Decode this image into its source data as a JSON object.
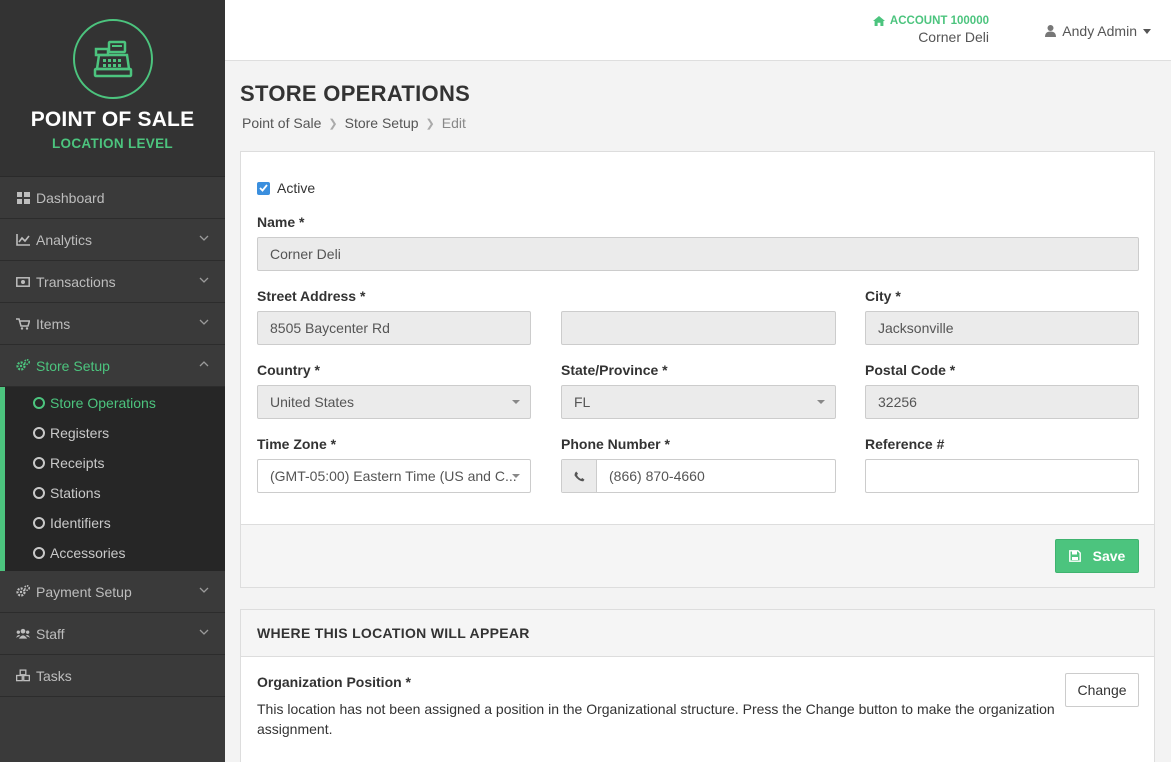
{
  "brand": {
    "title": "POINT OF SALE",
    "subtitle": "LOCATION LEVEL",
    "logo_icon": "cash-register-icon",
    "accent": "#4cc47e"
  },
  "sidebar": {
    "items": [
      {
        "label": "Dashboard",
        "icon": "dashboard-icon"
      },
      {
        "label": "Analytics",
        "icon": "chart-icon"
      },
      {
        "label": "Transactions",
        "icon": "money-icon"
      },
      {
        "label": "Items",
        "icon": "cart-icon"
      },
      {
        "label": "Store Setup",
        "icon": "cogs-icon"
      },
      {
        "label": "Payment Setup",
        "icon": "cogs-icon"
      },
      {
        "label": "Staff",
        "icon": "users-icon"
      },
      {
        "label": "Tasks",
        "icon": "cubes-icon"
      }
    ],
    "store_setup_sub": [
      "Store Operations",
      "Registers",
      "Receipts",
      "Stations",
      "Identifiers",
      "Accessories"
    ]
  },
  "topbar": {
    "account": "ACCOUNT 100000",
    "account_name": "Corner Deli",
    "user": "Andy Admin"
  },
  "page": {
    "title": "STORE OPERATIONS",
    "breadcrumb": [
      "Point of Sale",
      "Store Setup",
      "Edit"
    ]
  },
  "form": {
    "active_label": "Active",
    "active_checked": true,
    "name_label": "Name *",
    "name_value": "Corner Deli",
    "street_label": "Street Address *",
    "street_value": "8505 Baycenter Rd",
    "street2_value": "",
    "city_label": "City *",
    "city_value": "Jacksonville",
    "country_label": "Country *",
    "country_value": "United States",
    "state_label": "State/Province *",
    "state_value": "FL",
    "postal_label": "Postal Code *",
    "postal_value": "32256",
    "timezone_label": "Time Zone *",
    "timezone_value": "(GMT-05:00) Eastern Time (US and C...",
    "phone_label": "Phone Number *",
    "phone_value": "(866) 870-4660",
    "reference_label": "Reference #",
    "reference_value": "",
    "save_label": "Save"
  },
  "location_panel": {
    "heading": "WHERE THIS LOCATION WILL APPEAR",
    "org_label": "Organization Position *",
    "org_text": "This location has not been assigned a position in the Organizational structure. Press the Change button to make the organization assignment.",
    "change_label": "Change"
  }
}
